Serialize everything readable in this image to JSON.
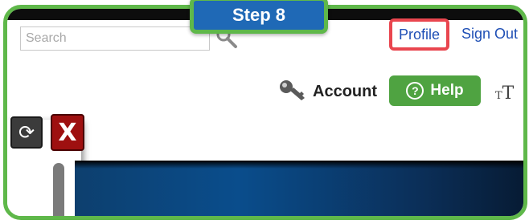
{
  "step_badge": {
    "label": "Step 8"
  },
  "search": {
    "placeholder": "Search",
    "value": ""
  },
  "header": {
    "profile_label": "Profile",
    "signout_label": "Sign Out",
    "account_label": "Account",
    "help_label": "Help",
    "help_icon_glyph": "?"
  },
  "panel": {
    "refresh_glyph": "⟳",
    "close_glyph": "X"
  },
  "colors": {
    "frame_border": "#5fb84a",
    "step_badge_bg": "#1f69b6",
    "profile_highlight": "#e9464f",
    "link": "#1f4fb5",
    "help_button": "#4fa341",
    "close_button": "#9e1010",
    "banner": "#0a4d8c"
  },
  "icons": [
    "search-icon",
    "key-icon",
    "help-icon",
    "text-size-icon",
    "refresh-icon",
    "close-icon"
  ]
}
